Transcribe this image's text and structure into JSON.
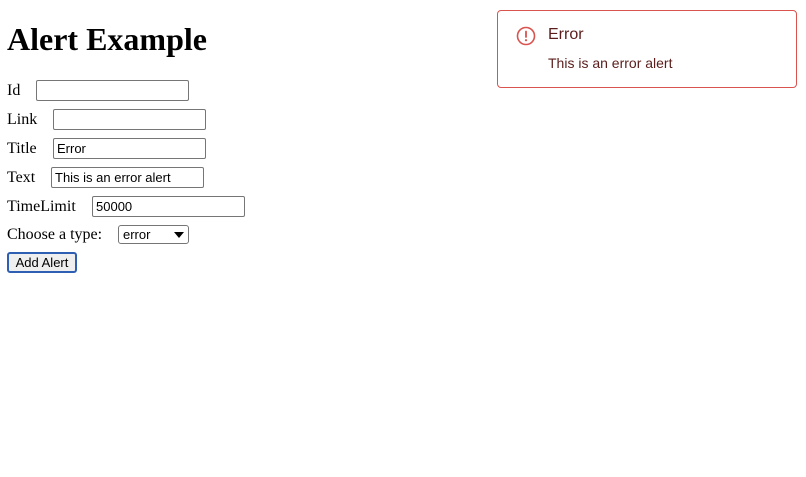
{
  "page": {
    "title": "Alert Example"
  },
  "form": {
    "id": {
      "label": "Id",
      "value": ""
    },
    "link": {
      "label": "Link",
      "value": ""
    },
    "title": {
      "label": "Title",
      "value": "Error"
    },
    "text": {
      "label": "Text",
      "value": "This is an error alert"
    },
    "time_limit": {
      "label": "TimeLimit",
      "value": "50000"
    },
    "type": {
      "label": "Choose a type:",
      "selected": "error"
    },
    "submit_label": "Add Alert"
  },
  "alert": {
    "title": "Error",
    "text": "This is an error alert",
    "icon": "error-circle-icon",
    "accent_color": "#d9534f",
    "text_color": "#5a1d1b"
  },
  "colors": {
    "button_focus_border": "#2f5fb3"
  }
}
